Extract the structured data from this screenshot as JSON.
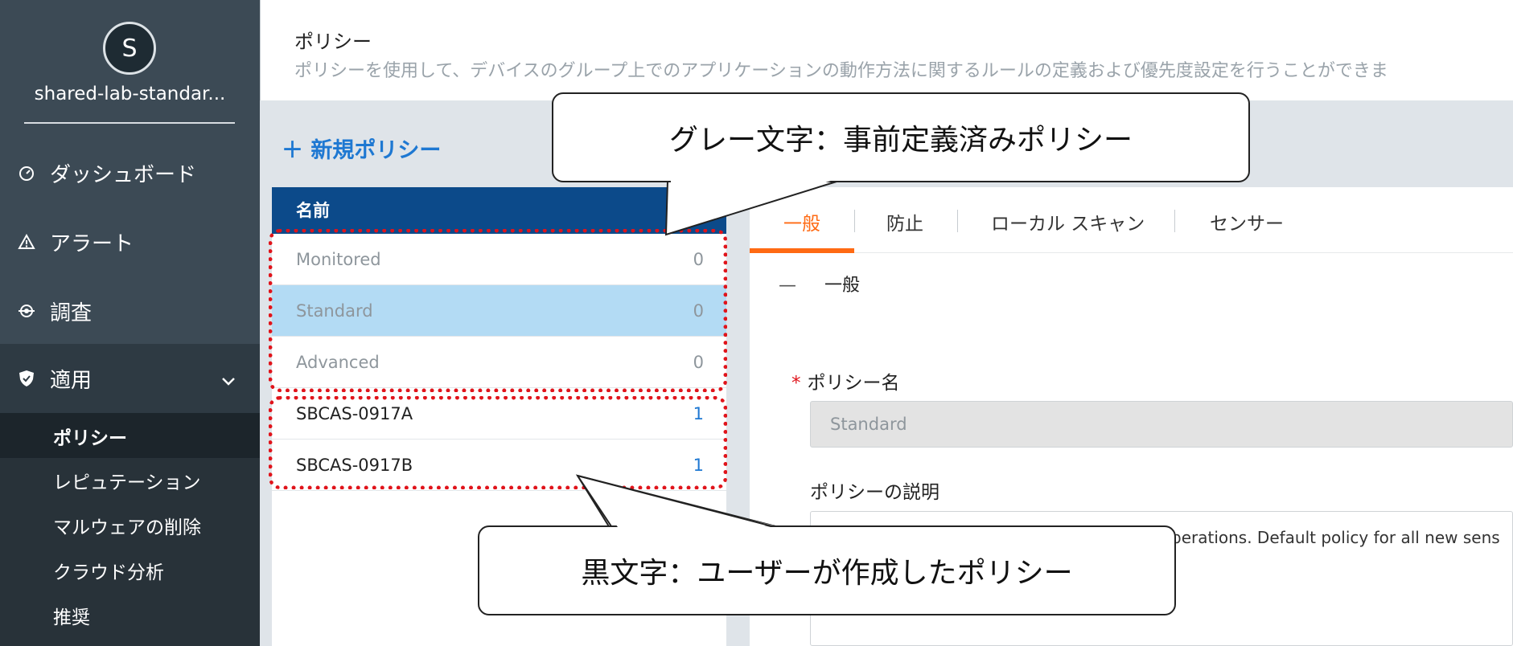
{
  "sidebar": {
    "avatar_letter": "S",
    "org_name": "shared-lab-standar...",
    "nav": [
      {
        "label": "ダッシュボード",
        "icon": "gauge-icon"
      },
      {
        "label": "アラート",
        "icon": "warning-icon"
      },
      {
        "label": "調査",
        "icon": "crosshair-icon"
      },
      {
        "label": "適用",
        "icon": "shield-icon"
      }
    ],
    "sub_items": [
      "ポリシー",
      "レピュテーション",
      "マルウェアの削除",
      "クラウド分析",
      "推奨"
    ]
  },
  "header": {
    "title": "ポリシー",
    "description": "ポリシーを使用して、デバイスのグループ上でのアプリケーションの動作方法に関するルールの定義および優先度設定を行うことができま"
  },
  "new_policy_label": "＋ 新規ポリシー",
  "policy_list": {
    "column_name": "名前",
    "rows": [
      {
        "name": "Monitored",
        "count": "0"
      },
      {
        "name": "Standard",
        "count": "0"
      },
      {
        "name": "Advanced",
        "count": "0"
      },
      {
        "name": "SBCAS-0917A",
        "count": "1"
      },
      {
        "name": "SBCAS-0917B",
        "count": "1"
      }
    ]
  },
  "detail": {
    "tabs": [
      "一般",
      "防止",
      "ローカル スキャン",
      "センサー"
    ],
    "section_toggle": "—",
    "section_title": "一般",
    "policy_name_label": "ポリシー名",
    "required_mark": "*",
    "policy_name_value": "Standard",
    "policy_desc_label": "ポリシーの説明",
    "policy_desc_value": "perations. Default policy for all new sens"
  },
  "callouts": {
    "gray_text": "グレー文字：事前定義済みポリシー",
    "black_text": "黒文字：ユーザーが作成したポリシー"
  },
  "colors": {
    "sidebar_bg": "#3c4a55",
    "list_header_bg": "#0c4a8a",
    "selected_row_bg": "#b3dbf4",
    "accent_blue": "#1e78d2",
    "tab_active": "#ff6a13",
    "annotation_red": "#e0141b"
  }
}
